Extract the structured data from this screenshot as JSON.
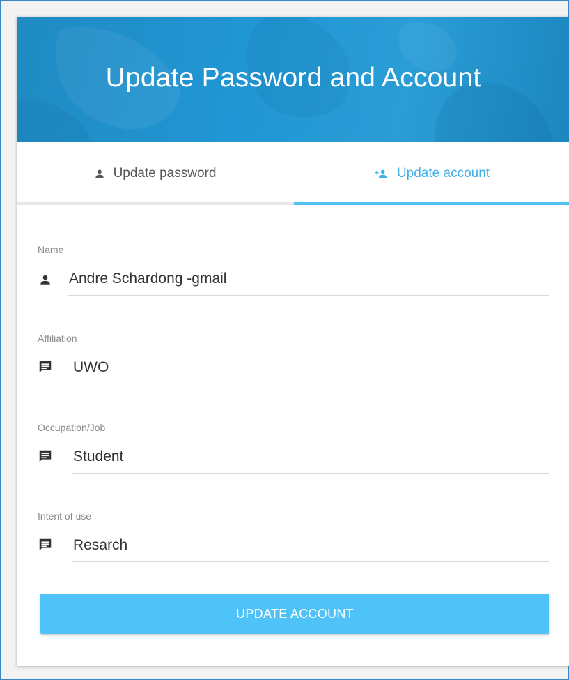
{
  "header": {
    "title": "Update Password and Account",
    "background_color": "#2196d4"
  },
  "tabs": [
    {
      "label": "Update password",
      "icon": "person-icon",
      "active": false
    },
    {
      "label": "Update account",
      "icon": "person-add-icon",
      "active": true
    }
  ],
  "accent_color": "#4fc3f7",
  "form": {
    "name": {
      "label": "Name",
      "value": "Andre Schardong -gmail",
      "icon": "person-icon"
    },
    "affiliation": {
      "label": "Affiliation",
      "value": "UWO",
      "icon": "comment-icon"
    },
    "occupation": {
      "label": "Occupation/Job",
      "value": "Student",
      "icon": "comment-icon"
    },
    "intent": {
      "label": "Intent of use",
      "value": "Resarch",
      "icon": "comment-icon"
    }
  },
  "submit_label": "UPDATE ACCOUNT"
}
